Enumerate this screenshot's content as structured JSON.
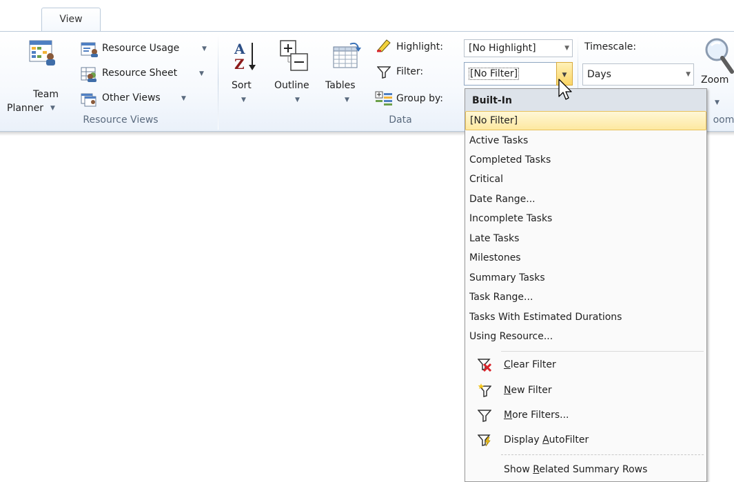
{
  "ribbon": {
    "tab_view": "View",
    "groups": {
      "resource_views": "Resource Views",
      "data": "Data",
      "zoom": "oom"
    },
    "team_planner": {
      "line1": "Team",
      "line2": "Planner"
    },
    "resource_usage": "Resource Usage",
    "resource_sheet": "Resource Sheet",
    "other_views": "Other Views",
    "sort": "Sort",
    "outline": "Outline",
    "tables": "Tables",
    "highlight_label": "Highlight:",
    "highlight_value": "[No Highlight]",
    "filter_label": "Filter:",
    "filter_value": "[No Filter]",
    "group_by_label": "Group by:",
    "timescale_label": "Timescale:",
    "timescale_value": "Days",
    "zoom": "Zoom"
  },
  "filter_menu": {
    "header": "Built-In",
    "items": [
      "[No Filter]",
      "Active Tasks",
      "Completed Tasks",
      "Critical",
      "Date Range...",
      "Incomplete Tasks",
      "Late Tasks",
      "Milestones",
      "Summary Tasks",
      "Task Range...",
      "Tasks With Estimated Durations",
      "Using Resource..."
    ],
    "selected_index": 0,
    "commands": {
      "clear_filter": {
        "pre": "",
        "key": "C",
        "post": "lear Filter",
        "icon": "clear-filter-icon"
      },
      "new_filter": {
        "pre": "",
        "key": "N",
        "post": "ew Filter",
        "icon": "new-filter-icon"
      },
      "more_filters": {
        "pre": "",
        "key": "M",
        "post": "ore Filters...",
        "icon": "funnel-icon"
      },
      "display_autofilter": {
        "pre": "Display ",
        "key": "A",
        "post": "utoFilter",
        "icon": "autofilter-icon"
      },
      "show_related": {
        "pre": "Show ",
        "key": "R",
        "post": "elated Summary Rows"
      }
    }
  },
  "colors": {
    "selection_fill": "#fde8a0",
    "selection_border": "#e8c15b",
    "ribbon_border": "#b9c9da",
    "menu_header": "#dde3ea"
  }
}
